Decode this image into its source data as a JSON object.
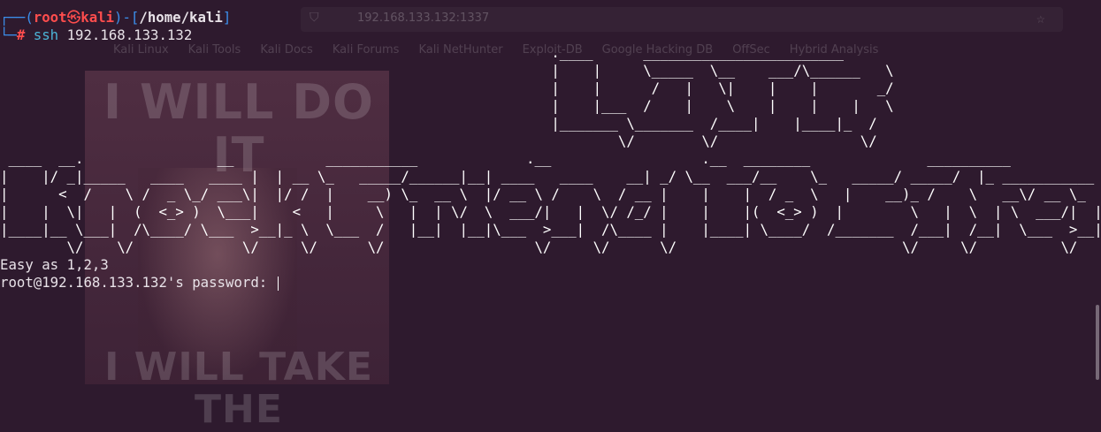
{
  "browser_ghost": {
    "url": "192.168.133.132",
    "port": "1337",
    "bookmarks": [
      "Kali Linux",
      "Kali Tools",
      "Kali Docs",
      "Kali Forums",
      "Kali NetHunter",
      "Exploit-DB",
      "Google Hacking DB",
      "OffSec",
      "Hybrid Analysis"
    ],
    "meme_top": "I WILL DO IT",
    "meme_bottom": "I WILL TAKE THE"
  },
  "prompt": {
    "corner_top": "┌──(",
    "user": "root",
    "skull": "㉿",
    "host": "kali",
    "mid": ")-[",
    "cwd": "/home/kali",
    "end": "]",
    "corner_bottom": "└─",
    "symbol": "#",
    "command": "ssh",
    "argument": "192.168.133.132"
  },
  "banner_lines": [
    "                                                                  .____      ________________________",
    "                                                                  |    |     \\_____  \\__    ___/\\______   \\",
    "                                                                  |    |      /   |   \\|    |    |       _/",
    "                                                                  |    |___  /    |    \\    |    |    |   \\",
    "                                                                  |_______ \\_______  /____|    |____|_  /",
    "                                                                          \\/        \\/                 \\/",
    " ____  __.                __           ___________             .__                  .__  ________              __________              __",
    "|    |/ _|_____   ____   ____ |  | __ \\_   _____/______|__| ____   ____    __| _/ \\__  ___/__    \\_   _____/ _____/  |_ ___________",
    "|      <  /    \\ /  _ \\_/ ___\\|  |/ /  |    __) \\_  __ \\  |/ __ \\ /    \\  / __ |    |    |  / _  \\   |    __)_ /    \\   __\\/ __ \\_  __ \\",
    "|    |  \\|   |  (  <_> )  \\___|    <   |     \\   |  | \\/  \\  ___/|   |  \\/ /_/ |    |    |(  <_> )  |        \\   |  \\  | \\  ___/|  | \\/",
    "|____|__ \\___|  /\\____/ \\___  >__|_ \\  \\___  /   |__|  |__|\\___  >___|  /\\____ |    |____| \\____/  /_______  /___|  /__|  \\___  >__|",
    "        \\/    \\/             \\/     \\/      \\/                  \\/     \\/      \\/                           \\/     \\/          \\/"
  ],
  "output": {
    "motd": "Easy as 1,2,3",
    "password_prompt": "root@192.168.133.132's password: "
  }
}
